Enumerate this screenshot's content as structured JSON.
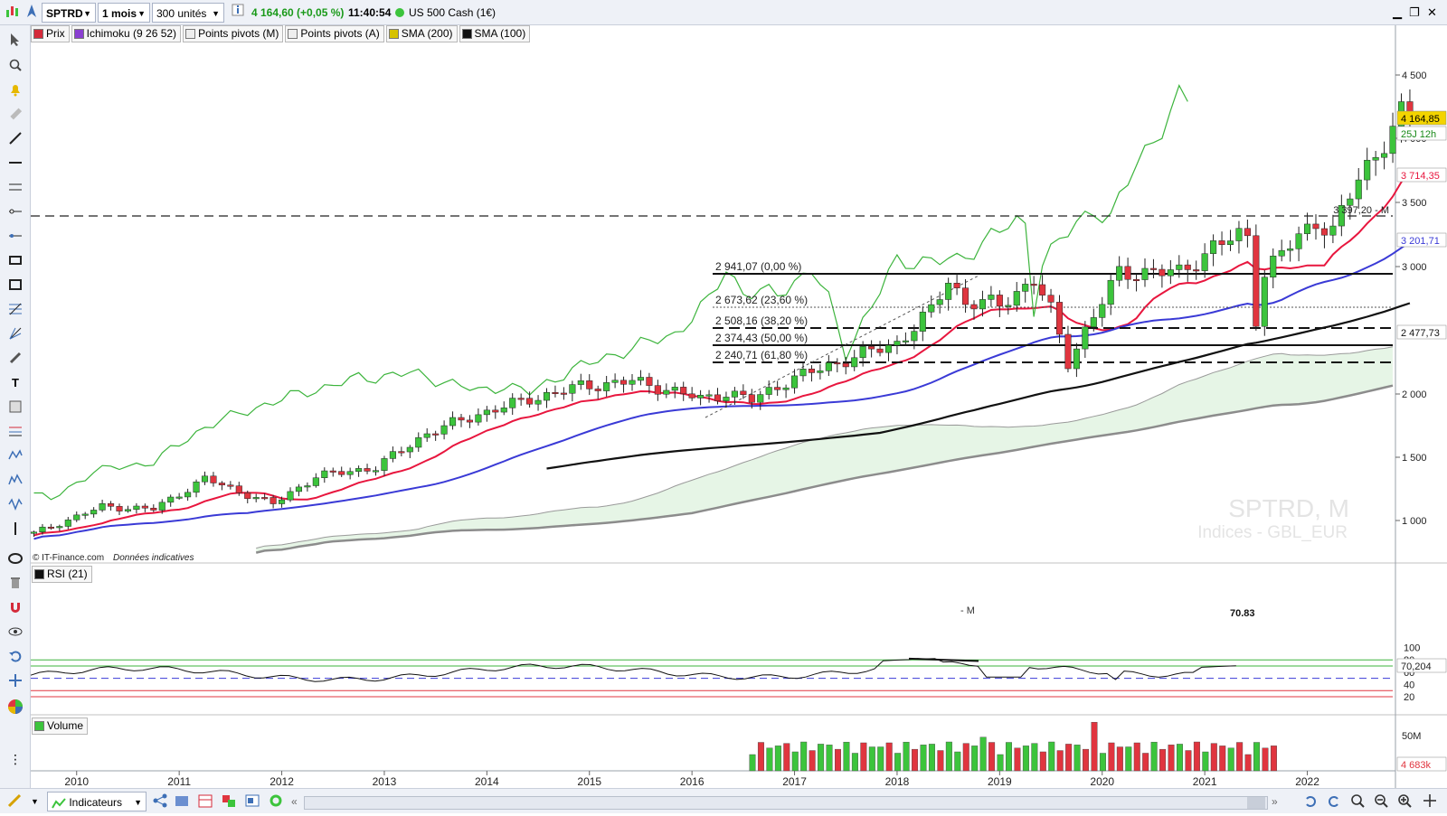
{
  "toolbar": {
    "symbol": "SPTRD",
    "period": "1 mois",
    "units": "300 unités",
    "quote": "4 164,60 (+0,05 %)",
    "time": "11:40:54",
    "instrument": "US 500 Cash (1€)"
  },
  "legend": {
    "items": [
      {
        "label": "Prix",
        "color": "#d42a3a"
      },
      {
        "label": "Ichimoku (9 26 52)",
        "color": "#8a3fd1"
      },
      {
        "label": "Points pivots (M)",
        "color": "#eeeeee"
      },
      {
        "label": "Points pivots (A)",
        "color": "#eeeeee"
      },
      {
        "label": "SMA (200)",
        "color": "#d6c200"
      },
      {
        "label": "SMA (100)",
        "color": "#111111"
      }
    ]
  },
  "price_axis": {
    "ticks": [
      "4 500",
      "4 000",
      "3 500",
      "3 000",
      "2 000",
      "1 500",
      "1 000"
    ],
    "last_price": "4 164,85",
    "countdown": "25J 12h",
    "kijun_value": "3 714,35",
    "tenkan_value": "3 201,71",
    "pivot_value": "2 477,73"
  },
  "annotations": {
    "pivot_line": "3 397,20 - M",
    "fib_levels": [
      "2 941,07 (0,00 %)",
      "2 673,62 (23,60 %)",
      "2 508,16 (38,20 %)",
      "2 374,43 (50,00 %)",
      "2 240,71 (61,80 %)"
    ],
    "watermark_symbol": "SPTRD, M",
    "watermark_market": "Indices - GBL_EUR",
    "source": "© IT-Finance.com",
    "source_note": "Données indicatives"
  },
  "rsi": {
    "label": "RSI (21)",
    "ticks": [
      "100",
      "80",
      "60",
      "40",
      "20"
    ],
    "current": "70,204",
    "peak_label": "70.83",
    "divergence_label": "- M"
  },
  "volume": {
    "label": "Volume",
    "ticks": [
      "50M"
    ],
    "current": "4 683k"
  },
  "time_axis": {
    "years": [
      "2010",
      "2011",
      "2012",
      "2013",
      "2014",
      "2015",
      "2016",
      "2017",
      "2018",
      "2019",
      "2020",
      "2021",
      "2022"
    ]
  },
  "bottombar": {
    "indicators_label": "Indicateurs"
  },
  "colors": {
    "bull": "#3cc43c",
    "bear": "#e0353f",
    "kijun": "#e8163e",
    "tenkan": "#3a3ad6",
    "chikou": "#3cb43c",
    "cloud": "#e6f5e6",
    "sma100": "#111111"
  }
}
